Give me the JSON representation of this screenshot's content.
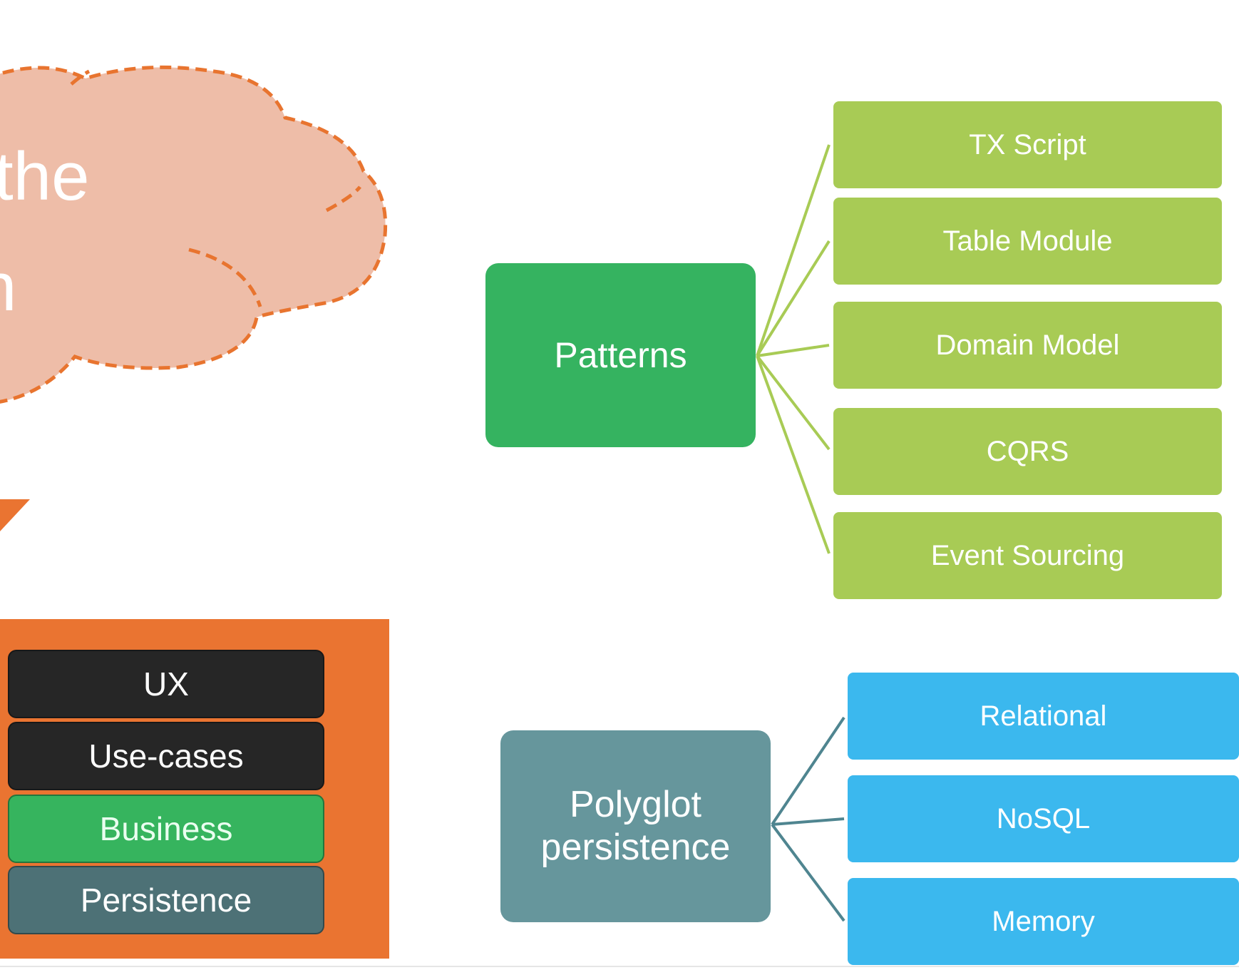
{
  "colors": {
    "cloud_fill": "#eebda8",
    "cloud_stroke": "#e8742f",
    "orange": "#ea7431",
    "patterns": "#35b360",
    "pattern_leaf": "#a8cb55",
    "polyglot": "#66969c",
    "storage_leaf": "#3bb8ee",
    "layer_dark": "#262626",
    "layer_business": "#36b45e",
    "layer_persistence": "#4d7176"
  },
  "cloud": {
    "line1": "the",
    "line2": "n"
  },
  "layers": [
    "UX",
    "Use-cases",
    "Business",
    "Persistence"
  ],
  "patterns": {
    "label": "Patterns",
    "items": [
      "TX Script",
      "Table Module",
      "Domain Model",
      "CQRS",
      "Event Sourcing"
    ]
  },
  "persistence": {
    "label_line1": "Polyglot",
    "label_line2": "persistence",
    "items": [
      "Relational",
      "NoSQL",
      "Memory"
    ]
  }
}
